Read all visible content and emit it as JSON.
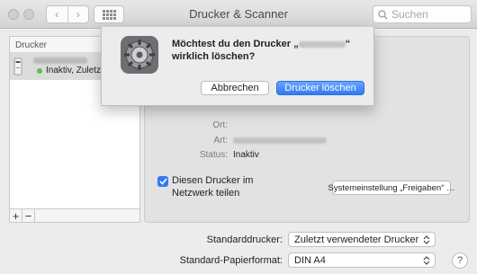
{
  "window": {
    "title": "Drucker & Scanner"
  },
  "toolbar": {
    "search_placeholder": "Suchen",
    "back_glyph": "‹",
    "forward_glyph": "›"
  },
  "sidebar": {
    "header": "Drucker",
    "printers": [
      {
        "status": "Inaktiv, Zuletzt b"
      }
    ],
    "add_glyph": "+",
    "remove_glyph": "−"
  },
  "details": {
    "location_label": "Ort:",
    "type_label": "Art:",
    "status_label": "Status:",
    "status_value": "Inaktiv",
    "share_label": "Diesen Drucker im Netzwerk teilen",
    "share_checked": true,
    "sharing_prefs_button": "Systemeinstellung „Freigaben“ …"
  },
  "defaults": {
    "default_printer_label": "Standarddrucker:",
    "default_printer_value": "Zuletzt verwendeter Drucker",
    "paper_size_label": "Standard-Papierformat:",
    "paper_size_value": "DIN A4"
  },
  "dialog": {
    "message_prefix": "Möchtest du den Drucker „",
    "message_suffix": "“ wirklich löschen?",
    "cancel_label": "Abbrechen",
    "delete_label": "Drucker löschen"
  },
  "help": {
    "glyph": "?"
  },
  "colors": {
    "accent": "#3478f6",
    "status_idle": "#5bbf4c"
  },
  "icons": [
    "back-icon",
    "forward-icon",
    "grid-icon",
    "search-icon",
    "printer-icon",
    "gear-icon",
    "checkmark-icon",
    "help-icon",
    "up-down-arrows-icon"
  ]
}
